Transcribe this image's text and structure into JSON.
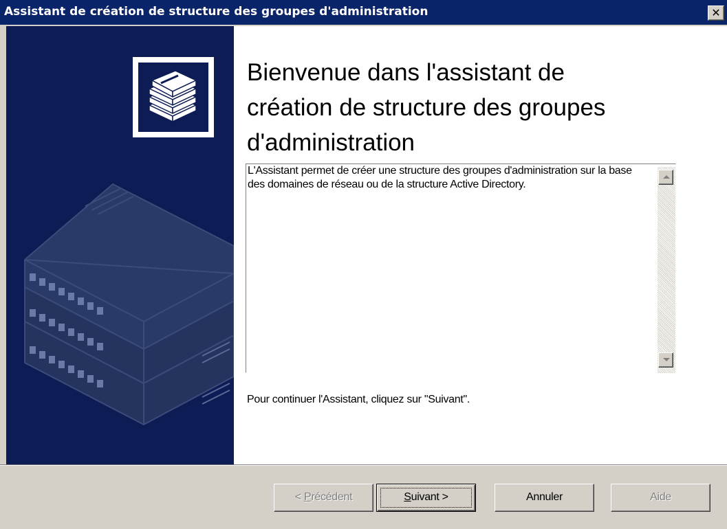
{
  "window": {
    "title": "Assistant de création de structure des groupes d'administration",
    "close_glyph": "✕"
  },
  "sidebar": {
    "icon": "stacked-servers-icon",
    "illustration": "server-stack-illustration",
    "background_color": "#0e1c55"
  },
  "content": {
    "heading": "Bienvenue dans l'assistant de\ncréation de structure des groupes\nd'administration",
    "description": "L'Assistant permet de créer une structure des groupes d'administration sur la base des domaines de réseau ou de la structure Active Directory.",
    "continue_hint": "Pour continuer l'Assistant, cliquez sur \"Suivant\"."
  },
  "buttons": {
    "back": {
      "prefix": "< ",
      "mnemonic": "P",
      "rest": "récédent",
      "enabled": false
    },
    "next": {
      "mnemonic": "S",
      "rest": "uivant >",
      "enabled": true,
      "default": true
    },
    "cancel": {
      "label": "Annuler",
      "enabled": true
    },
    "help": {
      "label": "Aide",
      "enabled": false
    }
  },
  "colors": {
    "titlebar": "#0a246a",
    "dialog_face": "#d4d0c8",
    "sidebar": "#0e1c55"
  }
}
